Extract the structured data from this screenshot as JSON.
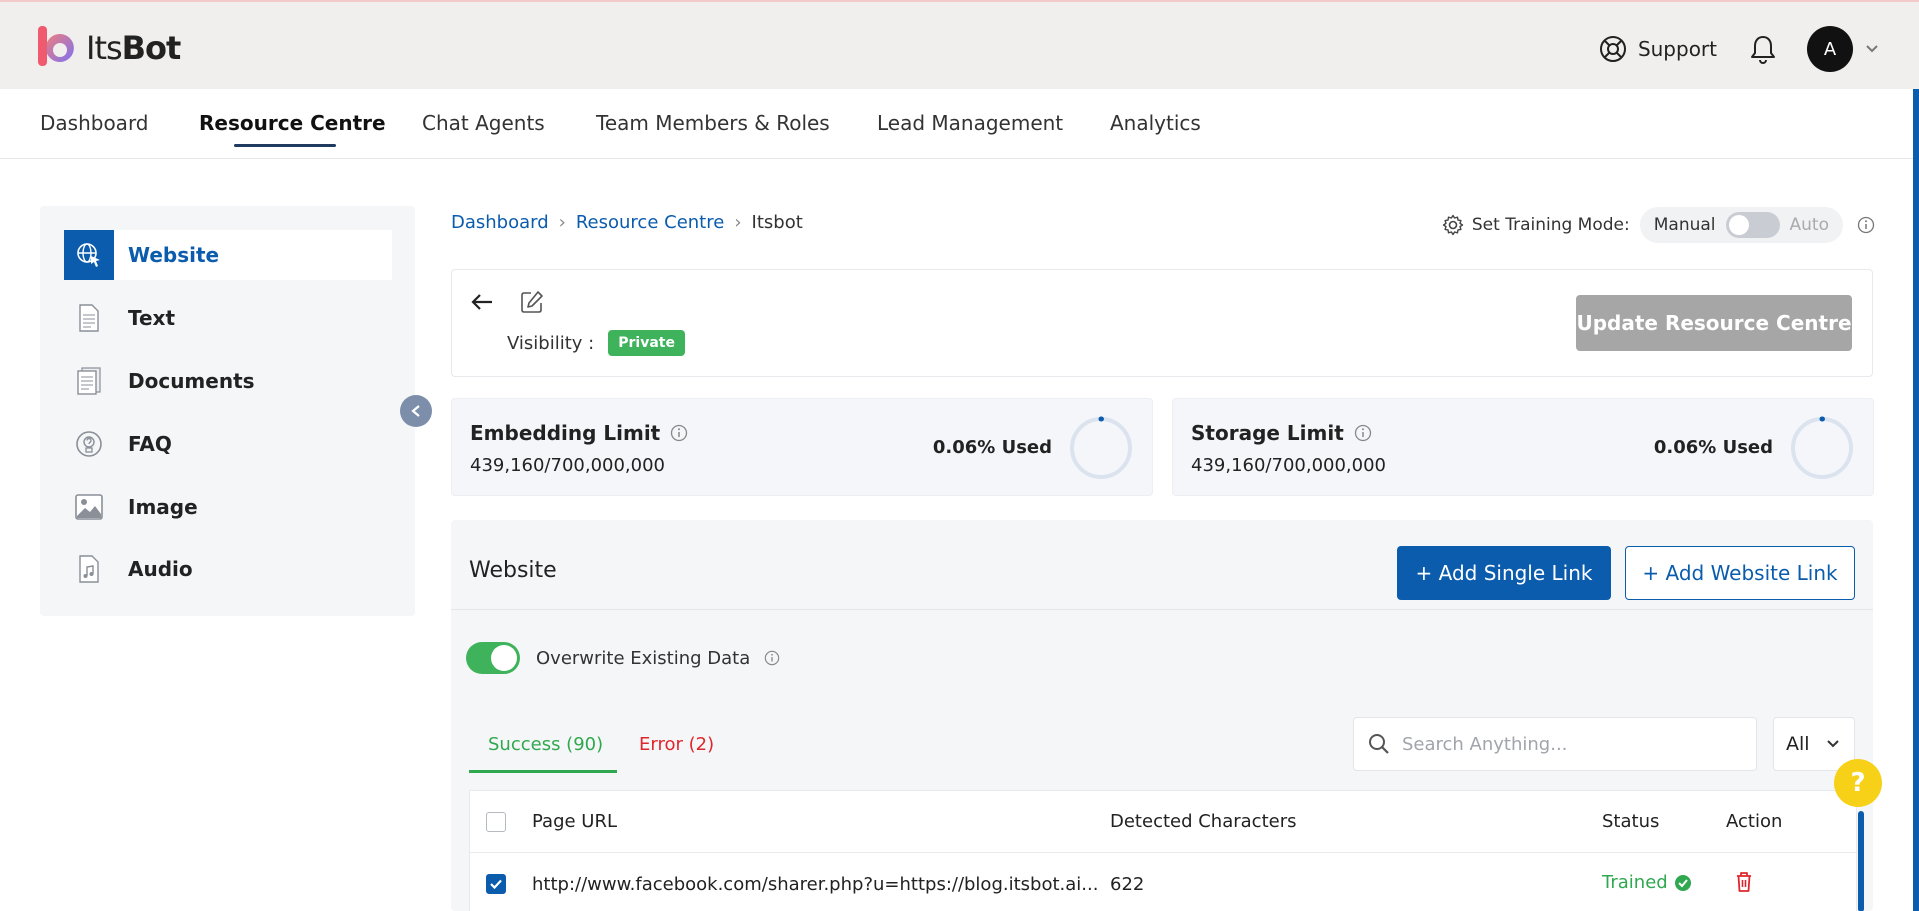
{
  "header": {
    "logo_text_light": "Its",
    "logo_text_bold": "Bot",
    "support_label": "Support",
    "avatar_initial": "A"
  },
  "nav": {
    "items": [
      "Dashboard",
      "Resource Centre",
      "Chat Agents",
      "Team Members & Roles",
      "Lead Management",
      "Analytics"
    ],
    "active": "Resource Centre"
  },
  "sidebar": {
    "items": [
      {
        "label": "Website",
        "icon": "globe-cursor-icon"
      },
      {
        "label": "Text",
        "icon": "text-document-icon"
      },
      {
        "label": "Documents",
        "icon": "documents-icon"
      },
      {
        "label": "FAQ",
        "icon": "faq-icon"
      },
      {
        "label": "Image",
        "icon": "image-icon"
      },
      {
        "label": "Audio",
        "icon": "audio-file-icon"
      }
    ],
    "active": "Website"
  },
  "breadcrumb": [
    "Dashboard",
    "Resource Centre",
    "Itsbot"
  ],
  "training": {
    "label": "Set Training Mode:",
    "manual": "Manual",
    "auto": "Auto"
  },
  "resource": {
    "visibility_label": "Visibility :",
    "visibility_value": "Private",
    "update_button": "Update Resource Centre"
  },
  "limits": [
    {
      "title": "Embedding Limit",
      "value": "439,160/700,000,000",
      "used": "0.06% Used",
      "used_fraction": 0.0006
    },
    {
      "title": "Storage Limit",
      "value": "439,160/700,000,000",
      "used": "0.06% Used",
      "used_fraction": 0.0006
    }
  ],
  "website": {
    "title": "Website",
    "add_single": "Add Single Link",
    "add_website": "Add Website Link",
    "overwrite_label": "Overwrite Existing Data",
    "overwrite_on": true,
    "tab_success": "Success (90)",
    "tab_error": "Error (2)",
    "search_placeholder": "Search Anything...",
    "filter_value": "All"
  },
  "table": {
    "columns": [
      "Page URL",
      "Detected Characters",
      "Status",
      "Action"
    ],
    "rows": [
      {
        "url": "http://www.facebook.com/sharer.php?u=https://blog.itsbot.ai...",
        "chars": "622",
        "status": "Trained",
        "checked": true
      }
    ]
  },
  "colors": {
    "primary": "#0b5cad",
    "success": "#2fa84f",
    "error": "#e0262d",
    "help": "#f7d117"
  }
}
